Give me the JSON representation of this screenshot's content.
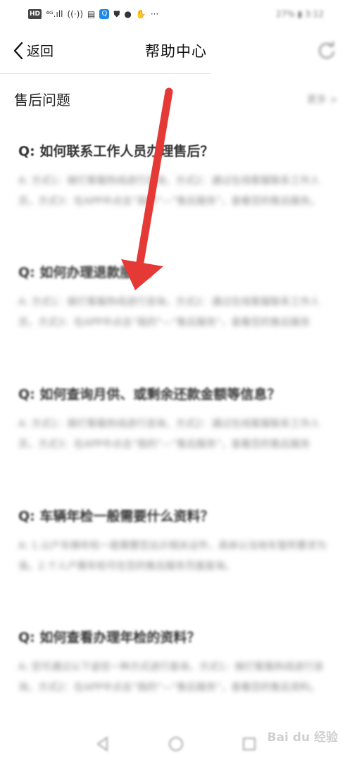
{
  "status_bar": {
    "hd": "HD",
    "signal": "⁴ᴳ.ıll",
    "wifi": "((·))",
    "right_text": "27% ▮ 3:12"
  },
  "nav": {
    "back_label": "返回",
    "title": "帮助中心"
  },
  "section": {
    "title": "售后问题",
    "more": "更多 >"
  },
  "faqs": [
    {
      "q": "Q:  如何联系工作人员办理售后？",
      "a": "A: 方式1：拨打客服热线进行咨询，方式2：通过在线客服联系工作人员，方式3：在APP中点击“我的”—“售后服务”，查看您的售后服务。"
    },
    {
      "q": "Q:  如何办理退款服务？",
      "a": "A: 方式1：拨打客服热线进行咨询，方式2：通过在线客服联系工作人员，方式3：在APP中点击“我的”—“售后服务”，查看您的售后服务"
    },
    {
      "q": "Q:  如何查询月供、或剩余还款金额等信息？",
      "a": "A: 方式1：拨打客服热线进行咨询，方式2：通过在线客服联系工作人员，方式3：在APP中点击“我的”—“售后服务”，查看您的售后服务"
    },
    {
      "q": "Q:  车辆年检一般需要什么资料？",
      "a": "A: 1.以户车辆年检一般需要您出示相关证件，具体以当地车管所要求为准。2.个人户需年检可在您的售后服务页面查询。"
    },
    {
      "q": "Q:  如何查看办理年检的资料？",
      "a": "A: 您可通过以下途径一种方式进行查询，方式1：拨打客服热线进行咨询，方式2：在APP中点击“我的”—“售后服务”，查看您的售后资料。"
    }
  ],
  "watermark": "Bai du 经验",
  "colors": {
    "arrow": "#e53935",
    "accent_blue": "#1e88e5"
  }
}
